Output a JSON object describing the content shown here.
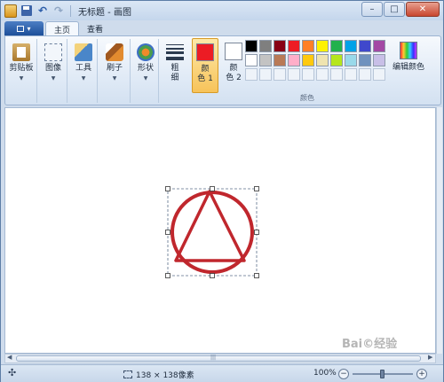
{
  "window": {
    "title": "无标题 - 画图",
    "controls": {
      "minimize": "–",
      "maximize": "□",
      "close": "✕"
    }
  },
  "quick_access": {
    "save": "save-icon",
    "undo": "↶",
    "redo": "↷"
  },
  "tabs": [
    {
      "label": "主页",
      "active": true
    },
    {
      "label": "查看",
      "active": false
    }
  ],
  "ribbon": {
    "clipboard": {
      "label": "剪贴板",
      "icon": "clipboard-icon"
    },
    "image": {
      "label": "图像",
      "icon": "image-select-icon"
    },
    "tools": {
      "label": "工具",
      "icon": "tools-icon"
    },
    "brushes": {
      "label": "刷子",
      "icon": "brush-icon"
    },
    "shapes": {
      "label": "形状",
      "icon": "shapes-icon"
    },
    "size": {
      "label_line1": "粗",
      "label_line2": "细"
    },
    "color1": {
      "label_line1": "颜",
      "label_line2": "色 1",
      "color": "#ec1c24"
    },
    "color2": {
      "label_line1": "颜",
      "label_line2": "色 2",
      "color": "#ffffff"
    },
    "palette_row1": [
      "#000000",
      "#7f7f7f",
      "#880015",
      "#ed1c24",
      "#ff7f27",
      "#fff200",
      "#22b14c",
      "#00a2e8",
      "#3f48cc",
      "#a349a4"
    ],
    "palette_row2": [
      "#ffffff",
      "#c3c3c3",
      "#b97a57",
      "#ffaec9",
      "#ffc90e",
      "#efe4b0",
      "#b5e61d",
      "#99d9ea",
      "#7092be",
      "#c8bfe7"
    ],
    "palette_row3_empty": 10,
    "colors_group_label": "颜色",
    "edit_colors": {
      "label": "编辑颜色"
    }
  },
  "drawing": {
    "shape_color": "#c0272d",
    "selection_color": "#5b6f8a"
  },
  "statusbar": {
    "move_icon": "✣",
    "selection_size": "138 × 138像素",
    "zoom": "100%",
    "zoom_minus": "−",
    "zoom_plus": "+"
  },
  "watermark": {
    "text": "Bai©经验"
  }
}
